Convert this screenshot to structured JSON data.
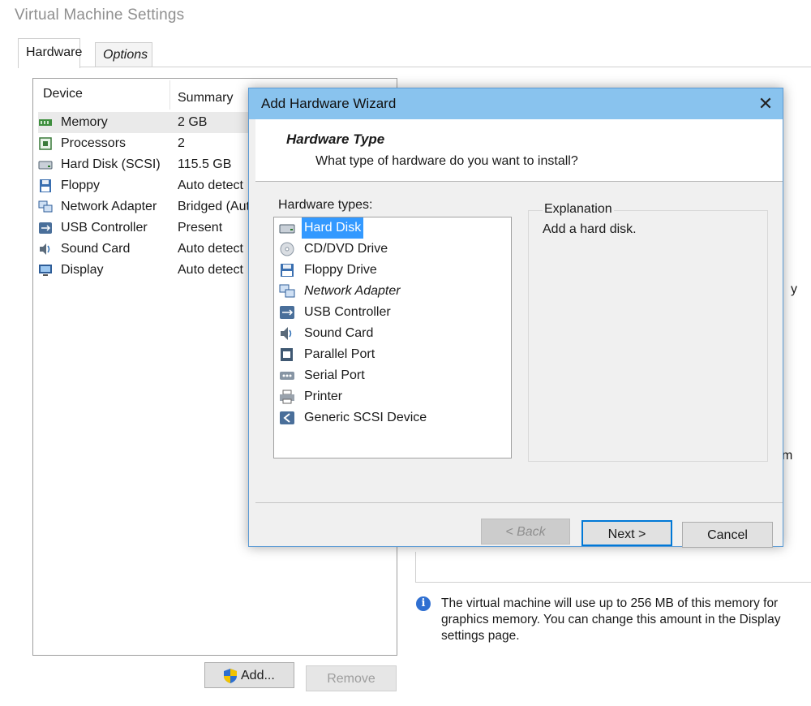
{
  "window": {
    "title": "Virtual Machine Settings"
  },
  "tabs": [
    {
      "label": "Hardware"
    },
    {
      "label": "Options"
    }
  ],
  "device_table": {
    "headers": {
      "device": "Device",
      "summary": "Summary"
    },
    "rows": [
      {
        "device": "Memory",
        "summary": "2 GB",
        "icon": "memory-icon"
      },
      {
        "device": "Processors",
        "summary": "2",
        "icon": "processor-icon"
      },
      {
        "device": "Hard Disk (SCSI)",
        "summary": "115.5 GB",
        "icon": "hard-disk-icon"
      },
      {
        "device": "Floppy",
        "summary": "Auto detect",
        "icon": "floppy-icon"
      },
      {
        "device": "Network Adapter",
        "summary": "Bridged (Auto",
        "icon": "network-adapter-icon"
      },
      {
        "device": "USB Controller",
        "summary": "Present",
        "icon": "usb-icon"
      },
      {
        "device": "Sound Card",
        "summary": "Auto detect",
        "icon": "sound-card-icon"
      },
      {
        "device": "Display",
        "summary": "Auto detect",
        "icon": "display-icon"
      }
    ]
  },
  "buttons": {
    "add": "Add...",
    "remove": "Remove"
  },
  "info": {
    "text": "The virtual machine will use up to 256 MB of this memory for graphics memory. You can change this amount in the Display settings page."
  },
  "edge_text": {
    "y": "y",
    "m": "m"
  },
  "wizard": {
    "title": "Add Hardware Wizard",
    "close_glyph": "✕",
    "header_title": "Hardware Type",
    "header_subtitle": "What type of hardware do you want to install?",
    "list_label": "Hardware types:",
    "items": [
      {
        "label": "Hard Disk",
        "icon": "hard-disk-icon"
      },
      {
        "label": "CD/DVD Drive",
        "icon": "cd-dvd-icon"
      },
      {
        "label": "Floppy Drive",
        "icon": "floppy-icon"
      },
      {
        "label": "Network Adapter",
        "icon": "network-adapter-icon"
      },
      {
        "label": "USB Controller",
        "icon": "usb-icon"
      },
      {
        "label": "Sound Card",
        "icon": "sound-card-icon"
      },
      {
        "label": "Parallel Port",
        "icon": "parallel-port-icon"
      },
      {
        "label": "Serial Port",
        "icon": "serial-port-icon"
      },
      {
        "label": "Printer",
        "icon": "printer-icon"
      },
      {
        "label": "Generic SCSI Device",
        "icon": "scsi-device-icon"
      }
    ],
    "selected": "Hard Disk",
    "explanation_label": "Explanation",
    "explanation_text": "Add a hard disk.",
    "buttons": {
      "back": "< Back",
      "next": "Next >",
      "cancel": "Cancel"
    }
  },
  "colors": {
    "titlebar": "#89c3ee",
    "selection": "#3399ff",
    "focus_border": "#0078d7"
  }
}
